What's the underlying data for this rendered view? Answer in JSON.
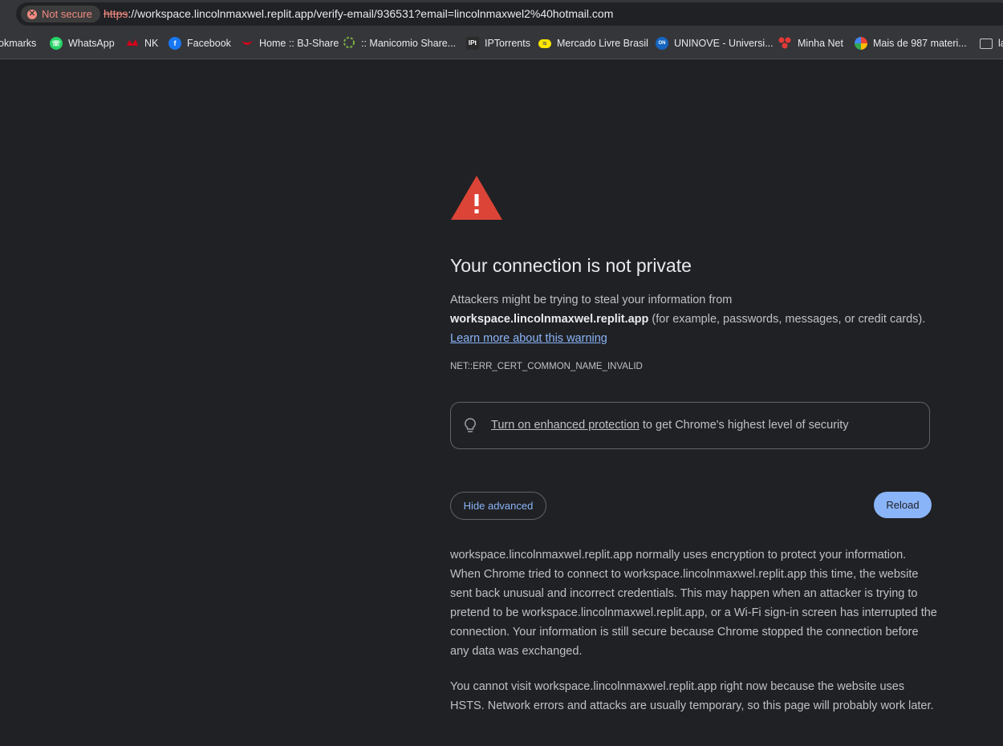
{
  "omnibox": {
    "security_chip": "Not secure",
    "url_scheme": "https",
    "url_rest": "://workspace.lincolnmaxwel.replit.app/verify-email/936531?email=lincolnmaxwel2%40hotmail.com"
  },
  "bookmarks": [
    {
      "label": "okmarks"
    },
    {
      "label": "WhatsApp",
      "icon": "whatsapp-icon",
      "color": "#25d366"
    },
    {
      "label": "NK",
      "icon": "nk-icon",
      "color": "#d0021b"
    },
    {
      "label": "Facebook",
      "icon": "facebook-icon",
      "color": "#1877f2"
    },
    {
      "label": "Home :: BJ-Share",
      "icon": "bjshare-icon",
      "color": "#d0021b"
    },
    {
      "label": ":: Manicomio Share...",
      "icon": "manicomio-icon",
      "color": "#7cb342"
    },
    {
      "label": "IPTorrents",
      "icon": "iptorrents-icon",
      "color": "#2b2b2b"
    },
    {
      "label": "Mercado Livre Brasil",
      "icon": "mercadolivre-icon",
      "color": "#ffe600"
    },
    {
      "label": "UNINOVE - Universi...",
      "icon": "uninove-icon",
      "color": "#1565c0"
    },
    {
      "label": "Minha Net",
      "icon": "net-icon",
      "color": "#e53935"
    },
    {
      "label": "Mais de 987 materi...",
      "icon": "materiais-icon",
      "color": "#fbbc04"
    },
    {
      "label": "la",
      "icon": "folder-icon"
    }
  ],
  "page": {
    "title": "Your connection is not private",
    "intro_prefix": "Attackers might be trying to steal your information from",
    "host": "workspace.lincolnmaxwel.replit.app",
    "intro_suffix": " (for example, passwords, messages, or credit cards).",
    "learn_more": "Learn more about this warning",
    "error_code": "NET::ERR_CERT_COMMON_NAME_INVALID",
    "protection_link": "Turn on enhanced protection",
    "protection_text": " to get Chrome's highest level of security",
    "hide_advanced": "Hide advanced",
    "reload": "Reload",
    "details_1": "workspace.lincolnmaxwel.replit.app normally uses encryption to protect your information. When Chrome tried to connect to workspace.lincolnmaxwel.replit.app this time, the website sent back unusual and incorrect credentials. This may happen when an attacker is trying to pretend to be workspace.lincolnmaxwel.replit.app, or a Wi-Fi sign-in screen has interrupted the connection. Your information is still secure because Chrome stopped the connection before any data was exchanged.",
    "details_2": "You cannot visit workspace.lincolnmaxwel.replit.app right now because the website uses HSTS. Network errors and attacks are usually temporary, so this page will probably work later."
  },
  "colors": {
    "background": "#202124",
    "warning": "#db4437",
    "accent": "#8ab4f8",
    "not_secure": "#f28b82"
  }
}
